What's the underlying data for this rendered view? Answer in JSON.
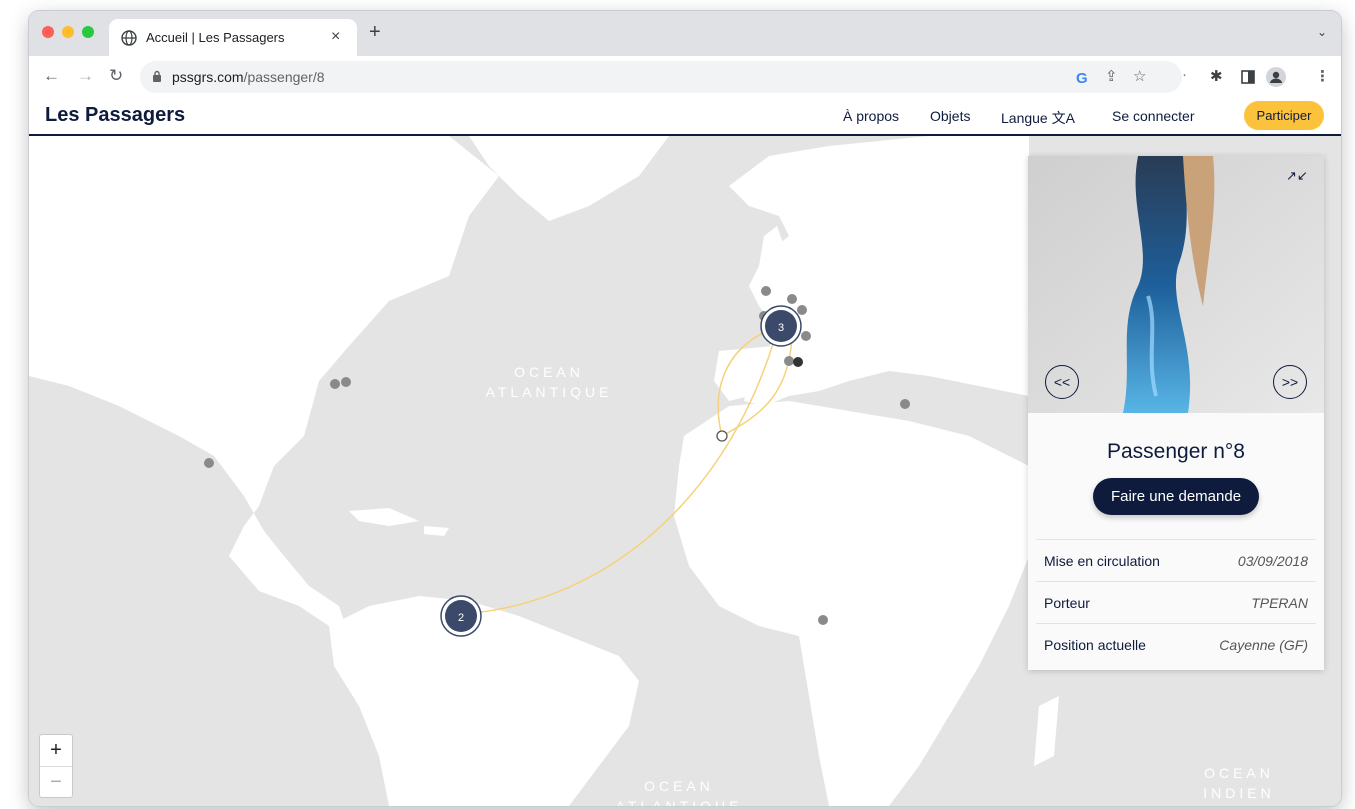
{
  "browser": {
    "tab_title": "Accueil | Les Passagers",
    "tab_close": "×",
    "new_tab": "+",
    "tabs_menu": "⌄",
    "url_host": "pssgrs.com",
    "url_path": "/passenger/8",
    "icons": [
      "back-icon",
      "forward-icon",
      "reload-icon",
      "lock-icon",
      "google-icon",
      "share-icon",
      "star-icon",
      "extensions-icon",
      "sidepanel-icon",
      "profile-icon",
      "menu-icon"
    ]
  },
  "header": {
    "brand": "Les Passagers",
    "nav": {
      "apropos": "À propos",
      "objets": "Objets",
      "langue": "Langue 文A",
      "connecter": "Se connecter",
      "participer": "Participer"
    }
  },
  "map": {
    "ocean_atlantique_top": "OCEAN\nATLANTIQUE",
    "ocean_atlantique_bottom": "OCEAN\nATLANTIQUE",
    "ocean_indien": "OCEAN\nINDIEN",
    "clusters": [
      {
        "label": "3"
      },
      {
        "label": "2"
      }
    ],
    "zoom_in": "+",
    "zoom_out": "−",
    "route_color": "#f5d27a",
    "cluster_color": "#3b4a6b"
  },
  "panel": {
    "title": "Passenger n°8",
    "cta": "Faire une demande",
    "prev": "<<",
    "next": ">>",
    "rows": [
      {
        "label": "Mise en circulation",
        "value": "03/09/2018"
      },
      {
        "label": "Porteur",
        "value": "TPERAN"
      },
      {
        "label": "Position actuelle",
        "value": "Cayenne (GF)"
      }
    ]
  }
}
